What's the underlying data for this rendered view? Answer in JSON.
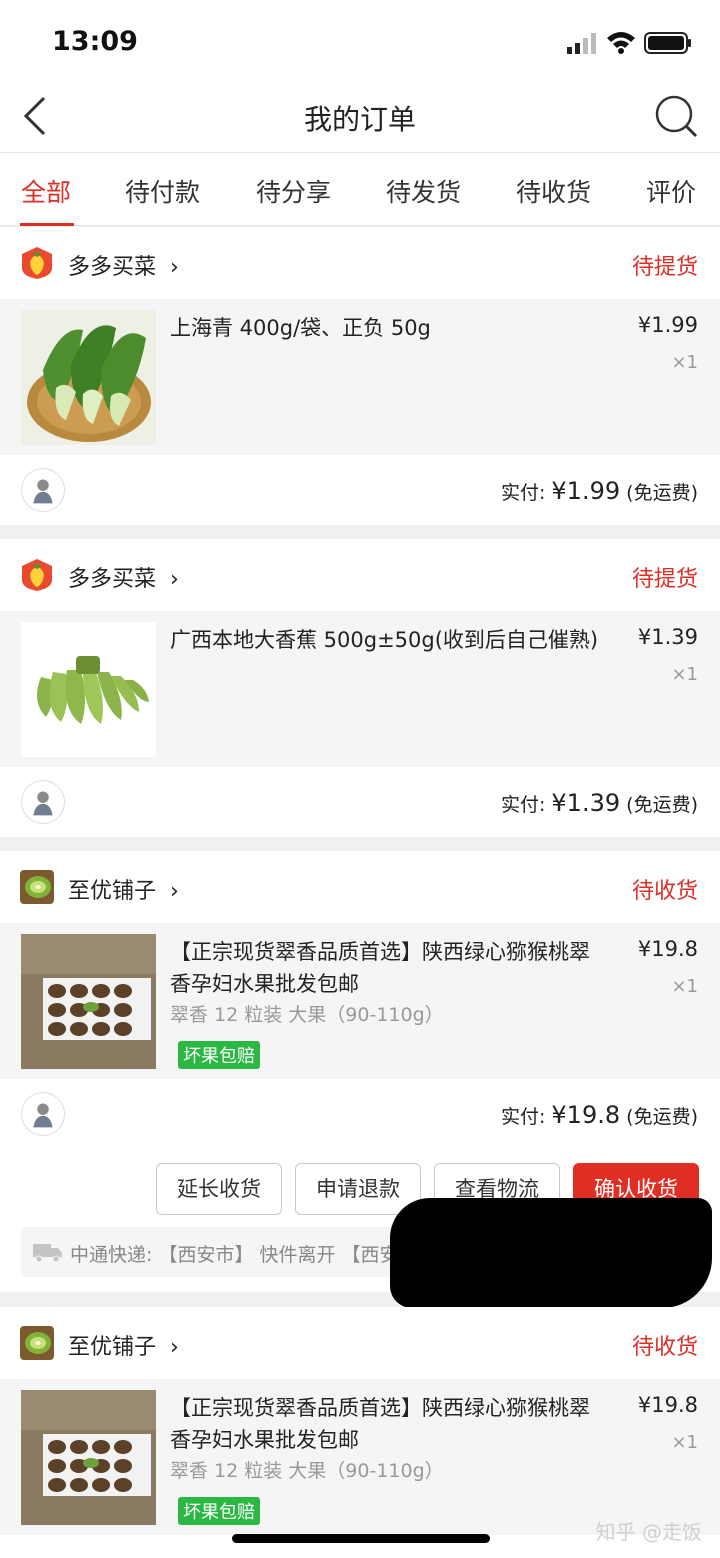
{
  "status_bar": {
    "time": "13:09"
  },
  "nav": {
    "title": "我的订单"
  },
  "tabs": [
    "全部",
    "待付款",
    "待分享",
    "待发货",
    "待收货",
    "评价"
  ],
  "orders": [
    {
      "shop": "多多买菜",
      "status": "待提货",
      "item": {
        "title": "上海青 400g/袋、正负 50g",
        "spec": "",
        "badge": "",
        "price": "¥1.99",
        "qty": "×1"
      },
      "pay_label": "实付: ",
      "pay_amount": "¥1.99",
      "pay_note": " (免运费)"
    },
    {
      "shop": "多多买菜",
      "status": "待提货",
      "item": {
        "title": "广西本地大香蕉 500g±50g(收到后自己催熟)",
        "spec": "",
        "badge": "",
        "price": "¥1.39",
        "qty": "×1"
      },
      "pay_label": "实付: ",
      "pay_amount": "¥1.39",
      "pay_note": " (免运费)"
    },
    {
      "shop": "至优铺子",
      "status": "待收货",
      "item": {
        "title": "【正宗现货翠香品质首选】陕西绿心猕猴桃翠香孕妇水果批发包邮",
        "spec": "翠香 12 粒装 大果（90-110g）",
        "badge": "坏果包赔",
        "price": "¥19.8",
        "qty": "×1"
      },
      "pay_label": "实付: ",
      "pay_amount": "¥19.8",
      "pay_note": " (免运费)",
      "buttons": [
        "延长收货",
        "申请退款",
        "查看物流",
        "确认收货"
      ],
      "logistics": "中通快递: 【西安市】 快件离开 【西安...】 已发往 【成都..."
    },
    {
      "shop": "至优铺子",
      "status": "待收货",
      "item": {
        "title": "【正宗现货翠香品质首选】陕西绿心猕猴桃翠香孕妇水果批发包邮",
        "spec": "翠香 12 粒装 大果（90-110g）",
        "badge": "坏果包赔",
        "price": "¥19.8",
        "qty": "×1"
      }
    }
  ],
  "watermark": "知乎 @走饭",
  "colors": {
    "accent": "#e02e24",
    "badge": "#2ab742"
  }
}
